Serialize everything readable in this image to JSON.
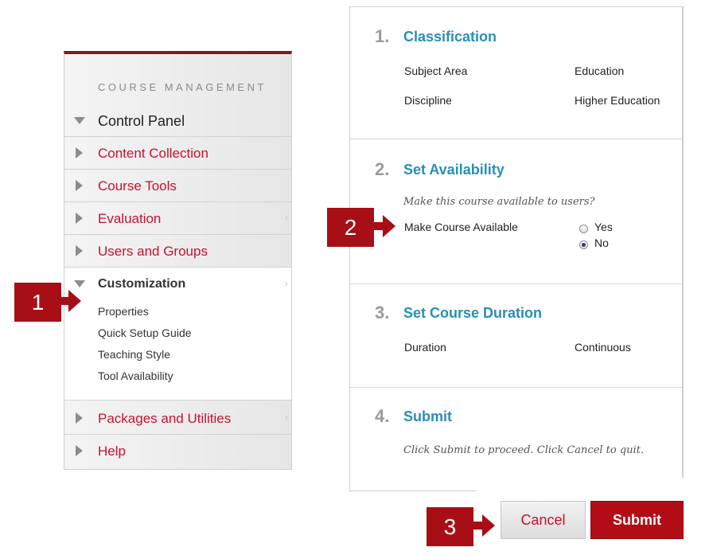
{
  "course_menu": {
    "heading": "COURSE MANAGEMENT",
    "control_panel": "Control Panel",
    "items": [
      {
        "label": "Content Collection"
      },
      {
        "label": "Course Tools"
      },
      {
        "label": "Evaluation"
      },
      {
        "label": "Users and Groups"
      }
    ],
    "customization": {
      "title": "Customization",
      "links": [
        "Properties",
        "Quick Setup Guide",
        "Teaching Style",
        "Tool Availability"
      ]
    },
    "bottom_items": [
      {
        "label": "Packages and Utilities"
      },
      {
        "label": "Help"
      }
    ]
  },
  "callouts": [
    "1",
    "2",
    "3"
  ],
  "form": {
    "steps": [
      {
        "number": "1.",
        "title": "Classification",
        "fields": [
          {
            "label": "Subject Area",
            "value": "Education"
          },
          {
            "label": "Discipline",
            "value": "Higher Education"
          }
        ]
      },
      {
        "number": "2.",
        "title": "Set Availability",
        "instruction": "Make this course available to users?",
        "field_label": "Make Course Available",
        "options": [
          {
            "label": "Yes",
            "selected": false
          },
          {
            "label": "No",
            "selected": true
          }
        ]
      },
      {
        "number": "3.",
        "title": "Set Course Duration",
        "fields": [
          {
            "label": "Duration",
            "value": "Continuous"
          }
        ]
      },
      {
        "number": "4.",
        "title": "Submit",
        "instruction": "Click Submit to proceed. Click Cancel to quit."
      }
    ]
  },
  "buttons": {
    "cancel": "Cancel",
    "submit": "Submit"
  },
  "colors": {
    "brand_red": "#a80e16",
    "link_red": "#c8102e",
    "step_title_blue": "#2a8fb3"
  }
}
